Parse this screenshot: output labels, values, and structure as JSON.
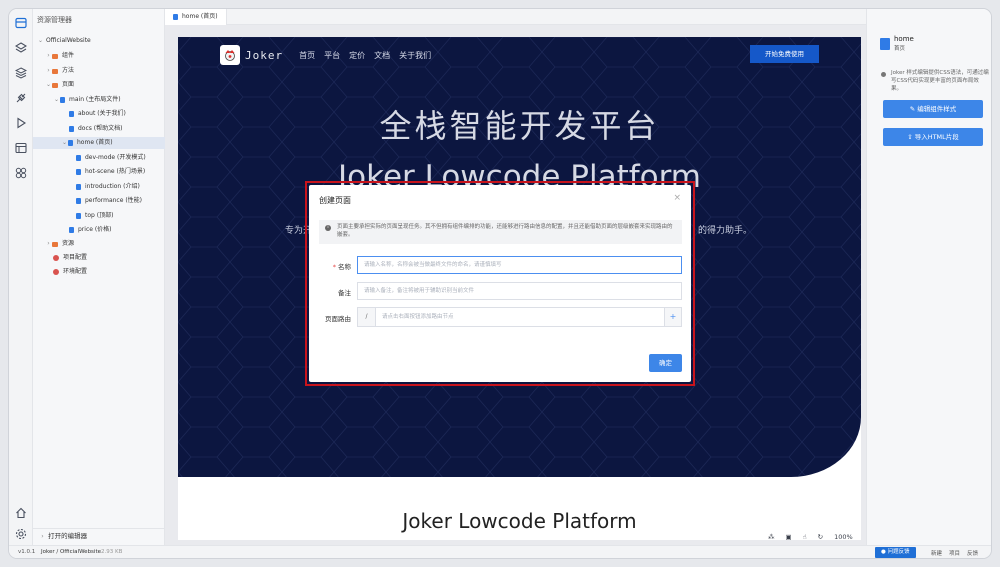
{
  "explorer": {
    "title": "资源管理器",
    "tree": [
      {
        "label": "OfficialWebsite",
        "kind": "root"
      },
      {
        "label": "组件",
        "kind": "folder"
      },
      {
        "label": "方法",
        "kind": "folder"
      },
      {
        "label": "页面",
        "kind": "folder"
      },
      {
        "label": "main (主布局文件)",
        "kind": "file"
      },
      {
        "label": "about (关于我们)",
        "kind": "file"
      },
      {
        "label": "docs (帮助文档)",
        "kind": "file"
      },
      {
        "label": "home (首页)",
        "kind": "file"
      },
      {
        "label": "dev-mode (开发模式)",
        "kind": "file"
      },
      {
        "label": "hot-scene (热门场景)",
        "kind": "file"
      },
      {
        "label": "introduction (介绍)",
        "kind": "file"
      },
      {
        "label": "performance (性能)",
        "kind": "file"
      },
      {
        "label": "top (顶部)",
        "kind": "file"
      },
      {
        "label": "price (价格)",
        "kind": "file"
      },
      {
        "label": "资源",
        "kind": "folder"
      },
      {
        "label": "项目配置",
        "kind": "config"
      },
      {
        "label": "环境配置",
        "kind": "config"
      }
    ],
    "open_editors": "打开的编辑器"
  },
  "editor": {
    "tab_label": "home (首页)"
  },
  "site": {
    "logo_text": "Joker",
    "nav": [
      "首页",
      "平台",
      "定价",
      "文档",
      "关于我们"
    ],
    "cta": "开始免费使用",
    "hero_title": "全栈智能开发平台",
    "hero_subtitle": "Joker Lowcode Platform",
    "hero_desc_left": "专为开发",
    "hero_desc_right": "的得力助手。",
    "section_title": "Joker Lowcode Platform"
  },
  "modal": {
    "title": "创建页面",
    "notice": "页面主要承担实际的页面呈现任务。其不但拥有组件编排的功能，还能够进行路由信息的配置，并且还能借助页面的层级嵌套来实现路由的嵌套。",
    "name_label": "名称",
    "name_placeholder": "请输入名称，名称会被当做最终文件的命名，请谨慎填写",
    "remark_label": "备注",
    "remark_placeholder": "请输入备注，备注将被用于辅助识别当前文件",
    "route_label": "页面路由",
    "route_prefix": "/",
    "route_placeholder": "请点击右面按钮添加路由节点",
    "route_add": "+",
    "confirm": "确定"
  },
  "zoom": {
    "level": "100%"
  },
  "inspector": {
    "name": "home",
    "subtitle": "首页",
    "tip": "Joker 样式编辑提供CSS语法，可通过编写CSS代码实现更丰富的页面布局效果。",
    "edit_style": "编辑组件样式",
    "import_html": "导入HTML片段"
  },
  "status": {
    "version": "v1.0.1",
    "project": "Joker / OfficialWebsite",
    "size": "2.93 KB",
    "help": "问题反馈",
    "item1": "新建",
    "item2": "项目",
    "item3": "反馈"
  }
}
